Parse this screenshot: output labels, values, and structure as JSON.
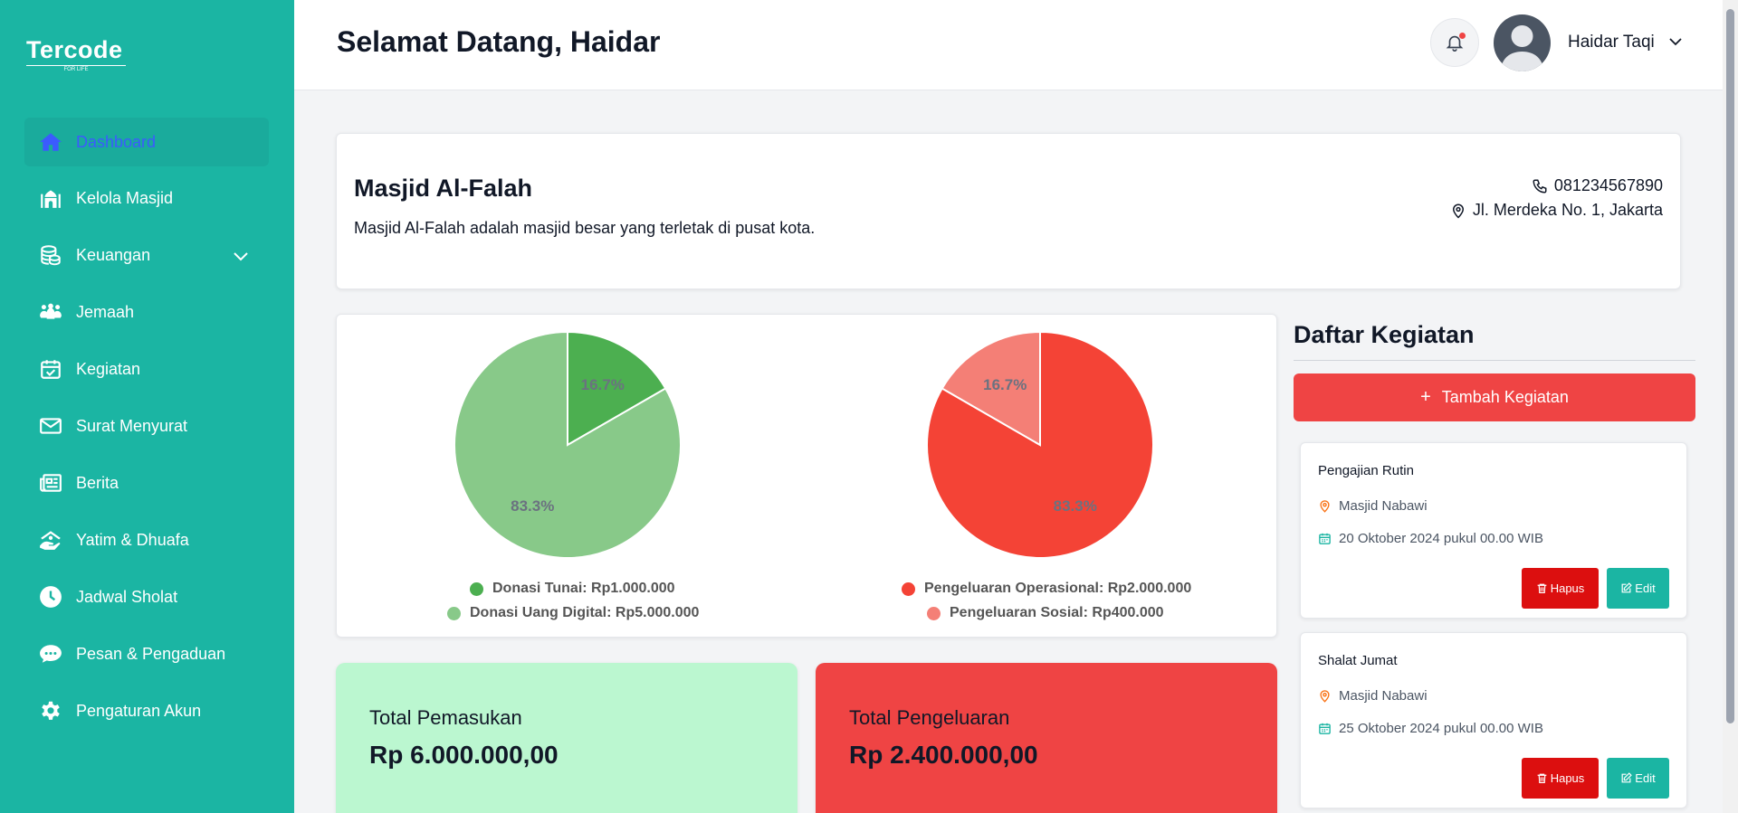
{
  "app": {
    "logo": "Tercode",
    "logo_tagline": "FOR LIFE"
  },
  "sidebar": {
    "items": [
      {
        "label": "Dashboard",
        "icon": "home-icon",
        "active": true
      },
      {
        "label": "Kelola Masjid",
        "icon": "mosque-icon"
      },
      {
        "label": "Keuangan",
        "icon": "coins-icon",
        "has_submenu": true
      },
      {
        "label": "Jemaah",
        "icon": "people-icon"
      },
      {
        "label": "Kegiatan",
        "icon": "calendar-check-icon"
      },
      {
        "label": "Surat Menyurat",
        "icon": "envelope-icon"
      },
      {
        "label": "Berita",
        "icon": "newspaper-icon"
      },
      {
        "label": "Yatim & Dhuafa",
        "icon": "charity-hands-icon"
      },
      {
        "label": "Jadwal Sholat",
        "icon": "clock-icon"
      },
      {
        "label": "Pesan & Pengaduan",
        "icon": "chat-bubble-icon"
      },
      {
        "label": "Pengaturan Akun",
        "icon": "gear-icon"
      }
    ]
  },
  "header": {
    "welcome": "Selamat Datang, Haidar",
    "user_name": "Haidar Taqi"
  },
  "mosque": {
    "name": "Masjid Al-Falah",
    "description": "Masjid Al-Falah adalah masjid besar yang terletak di pusat kota.",
    "phone": "081234567890",
    "address": "Jl. Merdeka No. 1, Jakarta"
  },
  "chart_data": [
    {
      "type": "pie",
      "title": "",
      "labels": [
        "Donasi Tunai: Rp1.000.000",
        "Donasi Uang Digital: Rp5.000.000"
      ],
      "values": [
        1000000,
        5000000
      ],
      "percent_labels": [
        "16.7%",
        "83.3%"
      ],
      "colors": [
        "#4caf50",
        "#88c989"
      ],
      "legend_placement": "bottom"
    },
    {
      "type": "pie",
      "title": "",
      "labels": [
        "Pengeluaran Operasional: Rp2.000.000",
        "Pengeluaran Sosial: Rp400.000"
      ],
      "values": [
        2000000,
        400000
      ],
      "percent_labels": [
        "83.3%",
        "16.7%"
      ],
      "colors": [
        "#f44336",
        "#f47f76"
      ],
      "legend_placement": "bottom"
    }
  ],
  "totals": {
    "income_label": "Total Pemasukan",
    "income_value": "Rp 6.000.000,00",
    "income_color": "#bbf7d0",
    "expense_label": "Total Pengeluaran",
    "expense_value": "Rp 2.400.000,00",
    "expense_color": "#ef4444"
  },
  "activities": {
    "title": "Daftar Kegiatan",
    "add_label": "Tambah Kegiatan",
    "delete_label": "Hapus",
    "edit_label": "Edit",
    "items": [
      {
        "name": "Pengajian Rutin",
        "location": "Masjid Nabawi",
        "datetime": "20 Oktober 2024 pukul 00.00 WIB"
      },
      {
        "name": "Shalat Jumat",
        "location": "Masjid Nabawi",
        "datetime": "25 Oktober 2024 pukul 00.00 WIB"
      }
    ]
  }
}
